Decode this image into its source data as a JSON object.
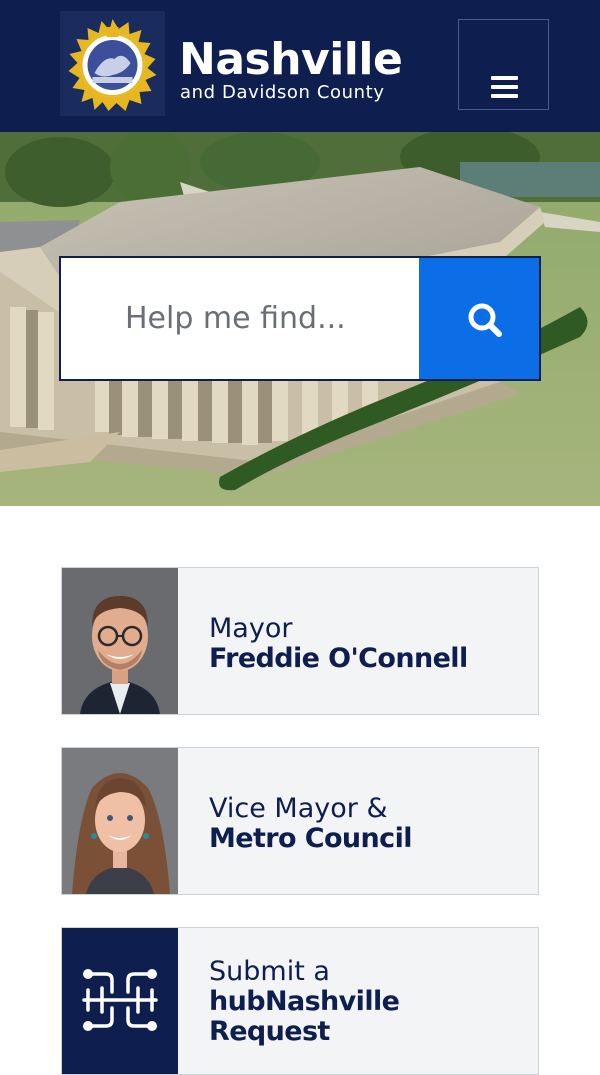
{
  "header": {
    "brand_title": "Nashville",
    "brand_subtitle": "and Davidson County",
    "menu_icon": "hamburger-menu-icon",
    "seal_icon": "metro-seal-logo"
  },
  "search": {
    "placeholder": "Help me find...",
    "button_icon": "search-icon"
  },
  "cards": [
    {
      "line1": "Mayor",
      "line2": "Freddie O'Connell",
      "image": "mayor-portrait"
    },
    {
      "line1": "Vice Mayor &",
      "line2": "Metro Council",
      "image": "vice-mayor-portrait"
    },
    {
      "line1": "Submit a",
      "line2": "hubNashville",
      "line3": "Request",
      "image": "hubnashville-circuit-icon"
    }
  ],
  "colors": {
    "navy": "#0e1e4f",
    "search_blue": "#0b6ee6",
    "card_bg": "#f3f4f6"
  }
}
